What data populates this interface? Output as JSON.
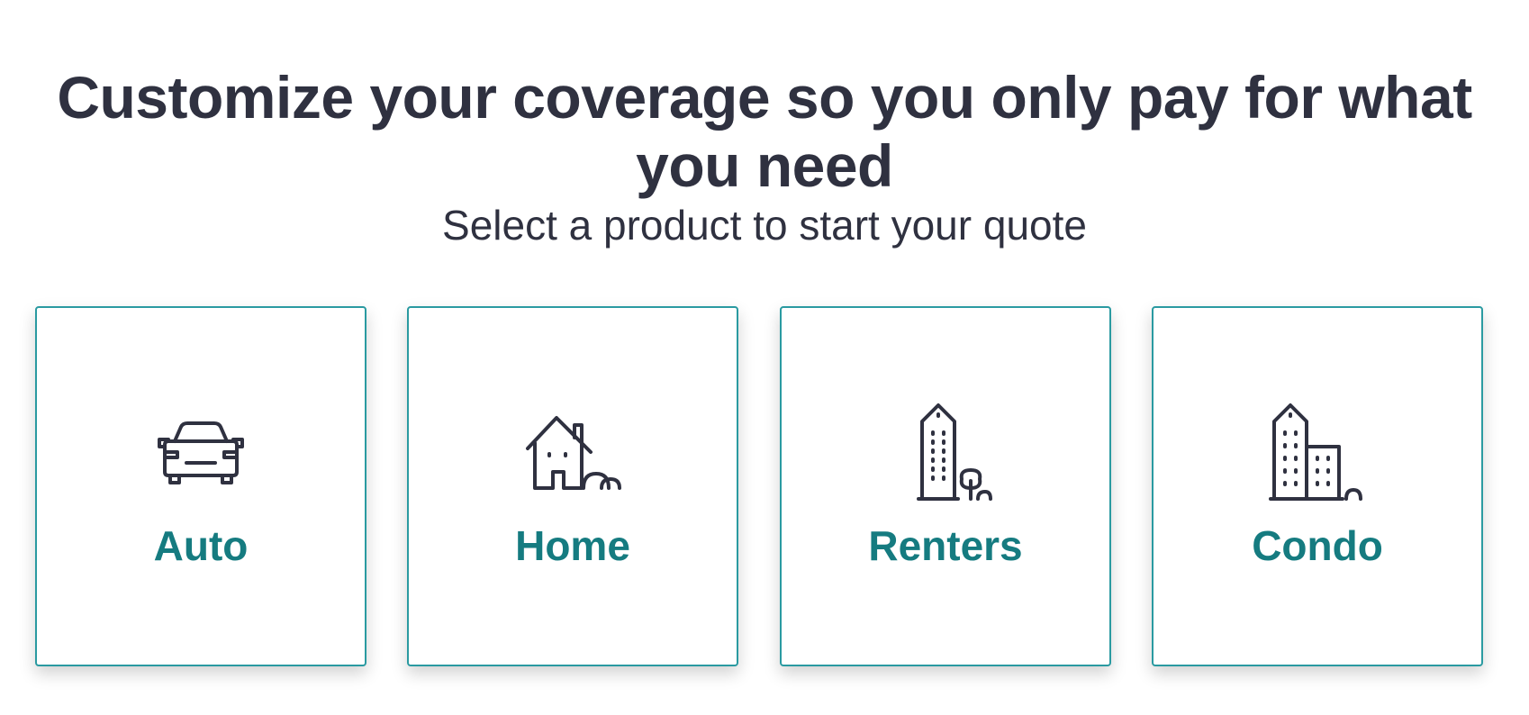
{
  "header": {
    "title": "Customize your coverage so you only pay for what you need",
    "subtitle": "Select a product to start your quote"
  },
  "products": [
    {
      "label": "Auto",
      "icon": "car-icon"
    },
    {
      "label": "Home",
      "icon": "house-icon"
    },
    {
      "label": "Renters",
      "icon": "apartment-building-icon"
    },
    {
      "label": "Condo",
      "icon": "condo-buildings-icon"
    }
  ],
  "colors": {
    "heading": "#2f3140",
    "accent": "#157b80",
    "card_border": "#2a9aa1",
    "icon_stroke": "#2f3140"
  }
}
